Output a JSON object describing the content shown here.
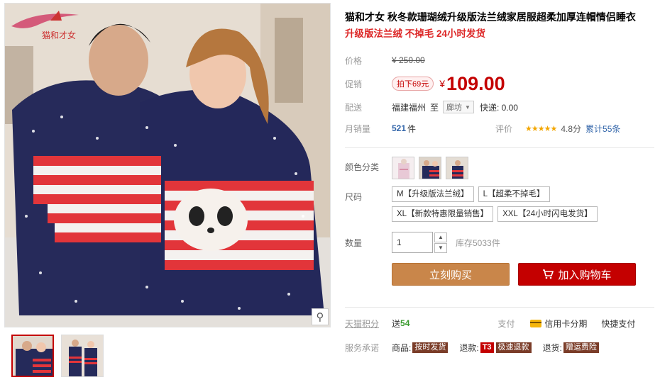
{
  "brand": {
    "logo_text": "猫和才女",
    "accent": "#c40000"
  },
  "gallery": {
    "zoom_icon": "magnifier-icon",
    "thumbnails": [
      {
        "name": "thumb-couple-front",
        "active": true
      },
      {
        "name": "thumb-couple-standing",
        "active": false
      }
    ]
  },
  "product": {
    "title": "猫和才女 秋冬款珊瑚绒升级版法兰绒家居服超柔加厚连帽情侣睡衣",
    "subtitle": "升级版法兰绒 不掉毛 24小时发货"
  },
  "price": {
    "label": "价格",
    "original": "¥ 250.00",
    "promo_label": "促销",
    "promo_tag": "拍下69元",
    "yuan": "¥",
    "promo_price": "109.00"
  },
  "shipping": {
    "label": "配送",
    "origin": "福建福州",
    "to": "至",
    "destination": "廊坊",
    "fee": "快递: 0.00"
  },
  "sales": {
    "label": "月销量",
    "count": "521",
    "unit": "件",
    "rating_label": "评价",
    "stars": "★★★★★",
    "score": "4.8分",
    "reviews": "累计55条"
  },
  "sku": {
    "color_label": "颜色分类",
    "size_label": "尺码",
    "sizes": [
      "M【升级版法兰绒】",
      "L【超柔不掉毛】",
      "XL【新款特惠限量销售】",
      "XXL【24小时闪电发货】"
    ],
    "qty_label": "数量",
    "qty_value": "1",
    "stock": "库存5033件"
  },
  "actions": {
    "buy_now": "立刻购买",
    "add_cart": "加入购物车"
  },
  "services": {
    "points_label": "天猫积分",
    "points_prefix": "送",
    "points_value": "54",
    "pay_label": "支付",
    "credit": "信用卡分期",
    "quick_pay": "快捷支付",
    "promise_label": "服务承诺",
    "goods_label": "商品:",
    "goods_tag": "按时发货",
    "refund_label": "退款:",
    "refund_t3": "T3",
    "refund_tag": "极速退款",
    "return_label": "退货:",
    "return_tag": "赠运费险"
  }
}
